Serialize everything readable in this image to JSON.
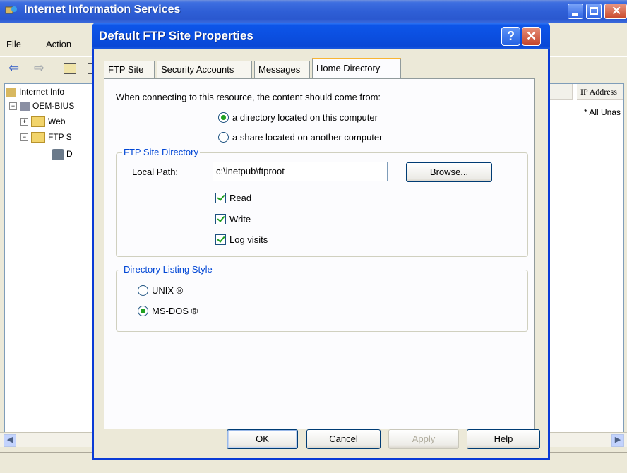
{
  "main_window": {
    "title": "Internet Information Services",
    "menu": [
      "File",
      "Action"
    ],
    "tree": [
      "Internet Info",
      "OEM-BIUS",
      "Web",
      "FTP S",
      "D"
    ],
    "columns": [
      "e",
      "IP Address"
    ],
    "list_value": "* All Unas"
  },
  "dialog": {
    "title": "Default FTP Site Properties",
    "help_glyph": "?",
    "tabs": [
      "FTP Site",
      "Security Accounts",
      "Messages",
      "Home Directory"
    ],
    "active_tab": "Home Directory",
    "source_prompt": "When connecting to this resource, the content should come from:",
    "source_options": [
      {
        "label": "a directory located on this computer",
        "selected": true
      },
      {
        "label": "a share located on another computer",
        "selected": false
      }
    ],
    "ftp_dir_group": {
      "legend": "FTP Site Directory",
      "local_path_label": "Local Path:",
      "local_path_value": "c:\\inetpub\\ftproot",
      "browse_label": "Browse...",
      "checks": [
        {
          "label": "Read",
          "checked": true
        },
        {
          "label": "Write",
          "checked": true
        },
        {
          "label": "Log visits",
          "checked": true
        }
      ]
    },
    "listing_group": {
      "legend": "Directory Listing Style",
      "options": [
        {
          "label": "UNIX ®",
          "selected": false
        },
        {
          "label": "MS-DOS ®",
          "selected": true
        }
      ]
    },
    "buttons": {
      "ok": "OK",
      "cancel": "Cancel",
      "apply": "Apply",
      "help": "Help"
    }
  },
  "colors": {
    "xp_blue": "#0a3bd6",
    "group_legend": "#0046d5",
    "radio_dot": "#21a121"
  }
}
